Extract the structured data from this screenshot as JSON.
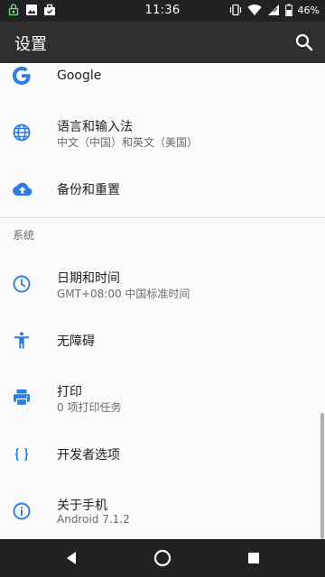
{
  "status_bar": {
    "time": "11:36",
    "battery": "46%",
    "left_icons": [
      "lock-sim-icon",
      "image-icon",
      "briefcase-icon"
    ],
    "right_icons": [
      "vibrate-icon",
      "wifi-icon",
      "signal-icon"
    ]
  },
  "app_bar": {
    "title": "设置",
    "search_icon": "search-icon"
  },
  "items_top": [
    {
      "label": "Google",
      "sub": "",
      "icon": "google-icon"
    },
    {
      "label": "语言和输入法",
      "sub": "中文（中国）和英文（美国）",
      "icon": "globe-icon"
    },
    {
      "label": "备份和重置",
      "sub": "",
      "icon": "cloud-upload-icon"
    }
  ],
  "section_system": "系统",
  "items_system": [
    {
      "label": "日期和时间",
      "sub": "GMT+08:00 中国标准时间",
      "icon": "clock-icon"
    },
    {
      "label": "无障碍",
      "sub": "",
      "icon": "accessibility-icon"
    },
    {
      "label": "打印",
      "sub": "0 项打印任务",
      "icon": "printer-icon"
    },
    {
      "label": "开发者选项",
      "sub": "",
      "icon": "braces-icon"
    },
    {
      "label": "关于手机",
      "sub": "Android 7.1.2",
      "icon": "info-icon"
    }
  ],
  "nav_bar": {
    "back_icon": "back-icon",
    "home_icon": "home-icon",
    "recents_icon": "recents-icon"
  },
  "colors": {
    "accent": "#2b7de1",
    "status_bar": "#222222",
    "app_bar": "#2f2f2f",
    "background": "#fafafa"
  }
}
